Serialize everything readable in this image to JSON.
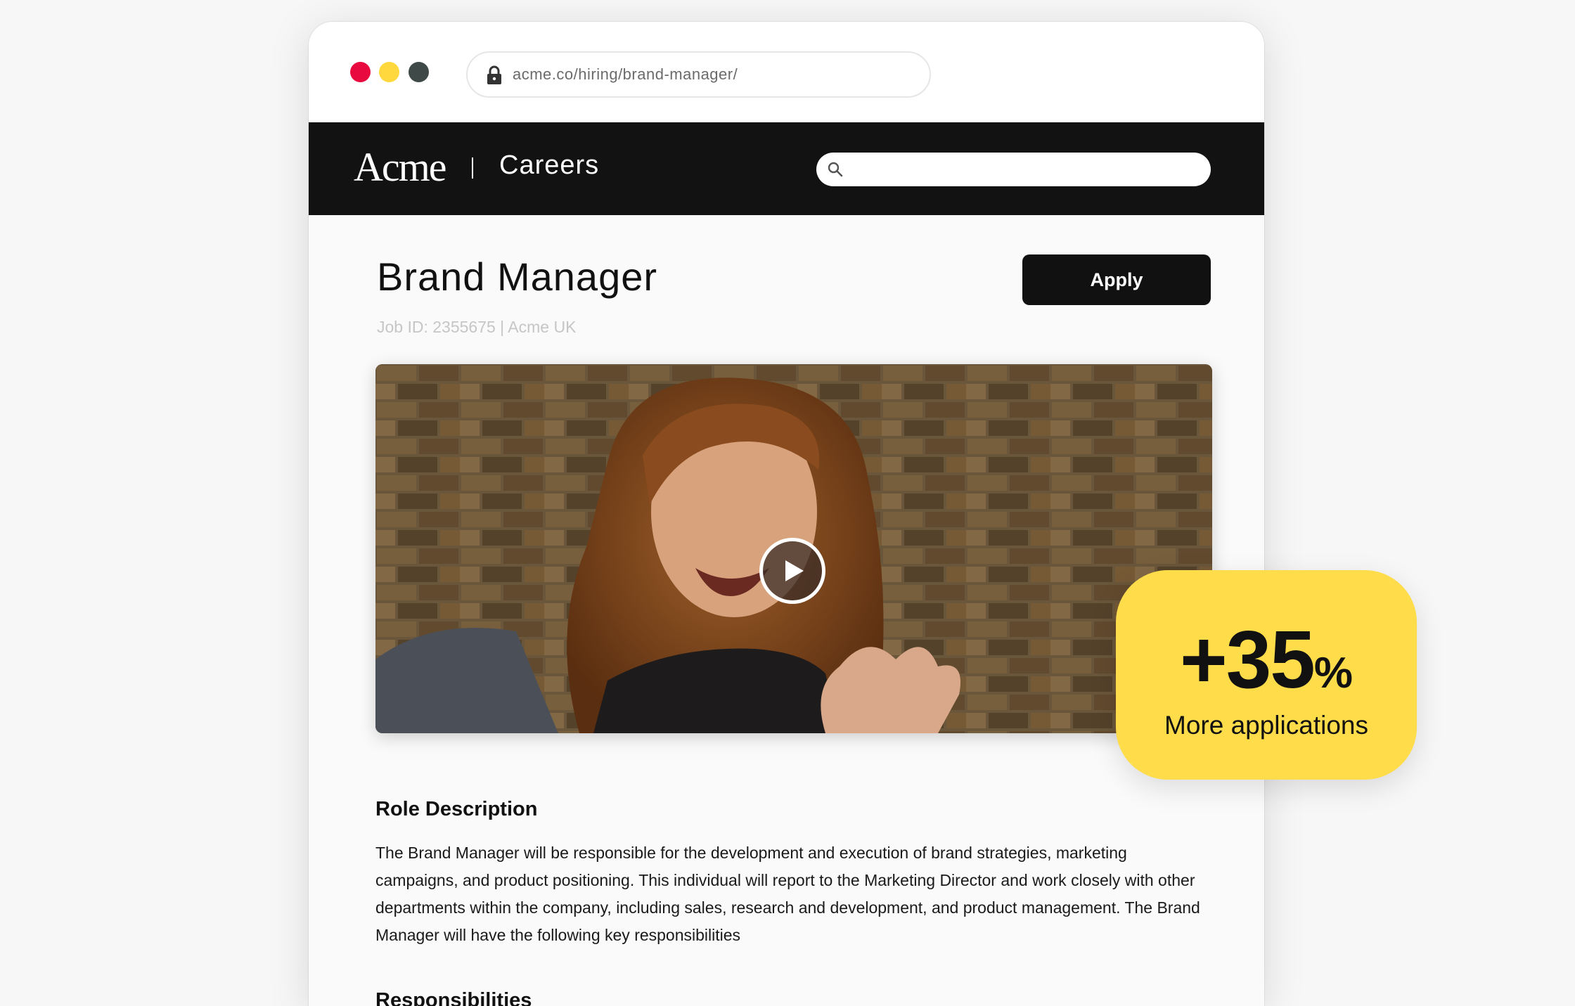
{
  "browser": {
    "url": "acme.co/hiring/brand-manager/"
  },
  "header": {
    "logo": "Acme",
    "section": "Careers",
    "search_placeholder": ""
  },
  "job": {
    "title": "Brand Manager",
    "meta": "Job ID: 2355675 | Acme UK",
    "apply_label": "Apply"
  },
  "content": {
    "role_heading": "Role Description",
    "role_text": "The Brand Manager will be responsible for the development and execution of brand strategies, marketing campaigns, and product positioning. This individual will report to the Marketing Director and work closely with other departments within the company, including sales, research and development, and product management. The Brand Manager will have the following key responsibilities",
    "responsibilities_heading": "Responsibilities"
  },
  "stat": {
    "value": "+35",
    "unit": "%",
    "label": "More applications"
  },
  "colors": {
    "accent_yellow": "#ffdc4a",
    "header_black": "#121212",
    "dot_red": "#e8093f",
    "dot_yellow": "#ffd83d",
    "dot_dark": "#3f4a48"
  },
  "icons": [
    "lock-icon",
    "search-icon",
    "play-icon"
  ]
}
